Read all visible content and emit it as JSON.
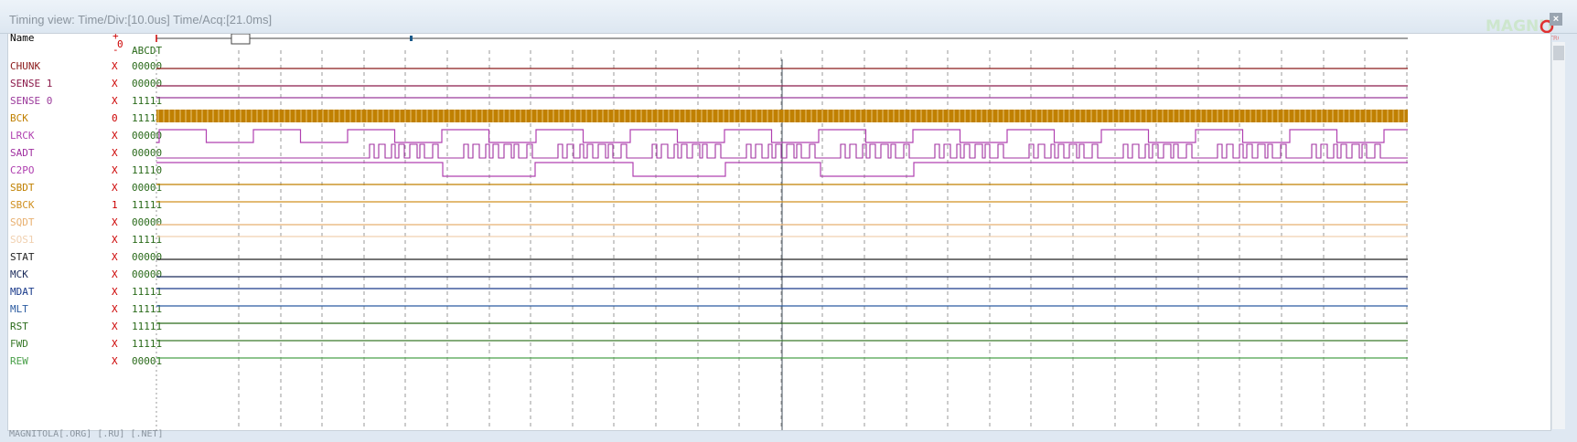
{
  "window": {
    "title": "Timing view:  Time/Div:[10.0us] Time/Acq:[21.0ms]",
    "logo_text": "MAGNITOLA",
    "footer": "MAGNITOLA[.ORG] [.RU] [.NET]"
  },
  "header": {
    "name_label": "Name",
    "plus": "+",
    "minus": "-",
    "zero": "0",
    "col_letters": "ABCDT"
  },
  "colors": {
    "wave_default": "#333333",
    "bck_fill": "#c08000",
    "grid": "#9a9a9a"
  },
  "signals": [
    {
      "name": "CHUNK",
      "trig": "X",
      "val": "00000",
      "color": "#8b1a1a"
    },
    {
      "name": "SENSE 1",
      "trig": "X",
      "val": "00000",
      "color": "#8b1a4a"
    },
    {
      "name": "SENSE 0",
      "trig": "X",
      "val": "11111",
      "color": "#9b3a9b"
    },
    {
      "name": "BCK",
      "trig": "0",
      "val": "11111",
      "color": "#c08000"
    },
    {
      "name": "LRCK",
      "trig": "X",
      "val": "00000",
      "color": "#b040b0"
    },
    {
      "name": "SADT",
      "trig": "X",
      "val": "00000",
      "color": "#a030a0"
    },
    {
      "name": "C2PO",
      "trig": "X",
      "val": "11110",
      "color": "#b040b0"
    },
    {
      "name": "SBDT",
      "trig": "X",
      "val": "00001",
      "color": "#c08000"
    },
    {
      "name": "SBCK",
      "trig": "1",
      "val": "11111",
      "color": "#d09020"
    },
    {
      "name": "SQDT",
      "trig": "X",
      "val": "00000",
      "color": "#e8b070"
    },
    {
      "name": "SOS1",
      "trig": "X",
      "val": "11111",
      "color": "#f0d0b0"
    },
    {
      "name": "STAT",
      "trig": "X",
      "val": "00000",
      "color": "#222222"
    },
    {
      "name": "MCK",
      "trig": "X",
      "val": "00000",
      "color": "#1a2a5a"
    },
    {
      "name": "MDAT",
      "trig": "X",
      "val": "11111",
      "color": "#1a3a8a"
    },
    {
      "name": "MLT",
      "trig": "X",
      "val": "11111",
      "color": "#2a5aa0"
    },
    {
      "name": "RST",
      "trig": "X",
      "val": "11111",
      "color": "#2a6a1a"
    },
    {
      "name": "FWD",
      "trig": "X",
      "val": "11111",
      "color": "#3a7a2a"
    },
    {
      "name": "REW",
      "trig": "X",
      "val": "00001",
      "color": "#4aa04a"
    }
  ]
}
